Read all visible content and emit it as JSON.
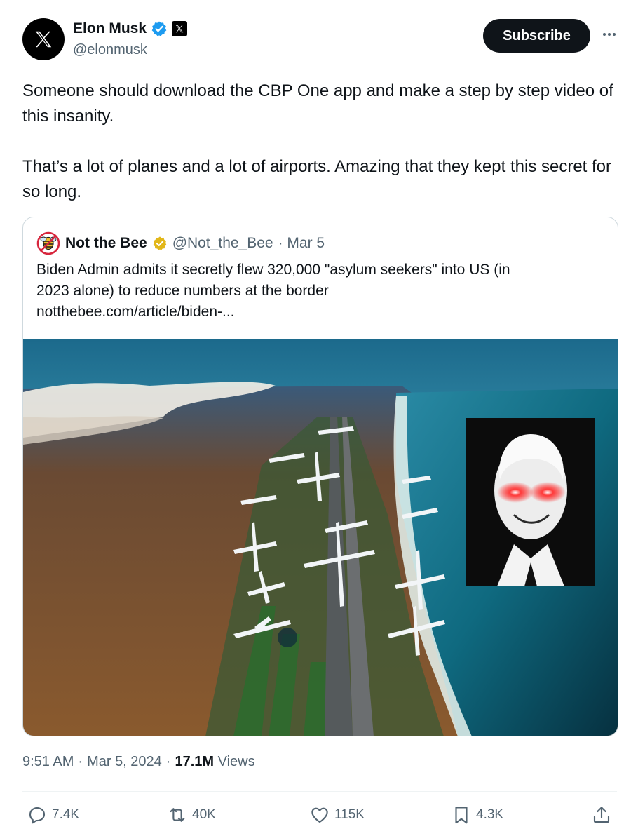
{
  "author": {
    "name": "Elon Musk",
    "handle": "@elonmusk",
    "avatar_icon": "x-logo-icon",
    "verified_icon": "verified-badge-icon",
    "affiliation_icon": "x-affiliation-icon"
  },
  "header": {
    "subscribe_label": "Subscribe",
    "more_icon": "more-icon"
  },
  "tweet": {
    "paragraphs": [
      "Someone should download the CBP One app and make a step by step video of this insanity.",
      "That’s a lot of planes and a lot of airports. Amazing that they kept this secret for so long."
    ]
  },
  "quote": {
    "name": "Not the Bee",
    "handle": "@Not_the_Bee",
    "date": "· Mar 5",
    "text_line1": "Biden Admin admits it secretly flew 320,000 \"asylum seekers\" into US (in",
    "text_line2": "2023 alone) to reduce numbers at the border",
    "link": "notthebee.com/article/biden-...",
    "avatar_icon": "not-the-bee-logo-icon",
    "verified_icon": "gold-verified-badge-icon"
  },
  "meta": {
    "time": "9:51 AM",
    "sep1": "·",
    "date": "Mar 5, 2024",
    "sep2": "·",
    "views_count": "17.1M",
    "views_label": "Views"
  },
  "actions": {
    "replies": "7.4K",
    "reposts": "40K",
    "likes": "115K",
    "bookmarks": "4.3K"
  },
  "colors": {
    "primary_text": "#0f1419",
    "secondary_text": "#536471",
    "verified_blue": "#1d9bf0",
    "gold_badge": "#e2b719",
    "border": "#cfd9de"
  }
}
